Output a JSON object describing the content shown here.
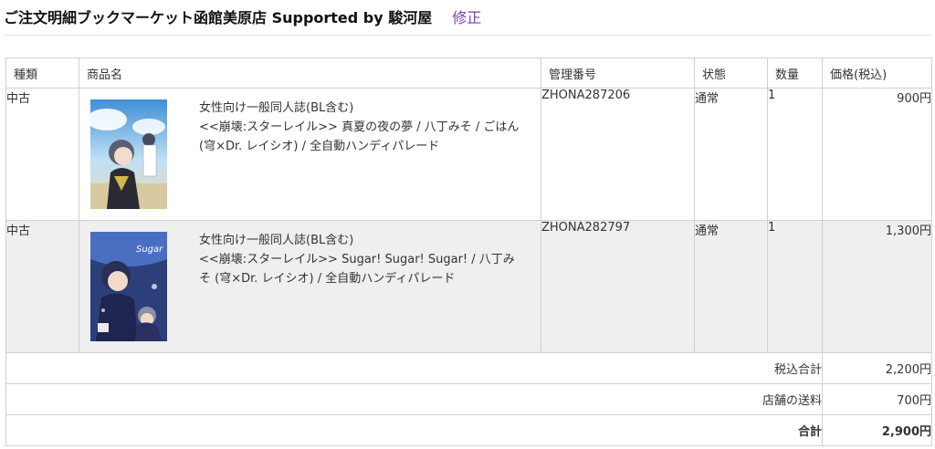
{
  "header": {
    "title": "ご注文明細ブックマーケット函館美原店 Supported by 駿河屋",
    "edit_label": "修正"
  },
  "table": {
    "columns": {
      "type": "種類",
      "product": "商品名",
      "code": "管理番号",
      "status": "状態",
      "qty": "数量",
      "price": "価格(税込)"
    },
    "items": [
      {
        "condition": "中古",
        "category": "女性向け一般同人誌(BL含む)",
        "title_line1": "<<崩壊:スターレイル>> 真夏の夜の夢 / 八丁みそ / ごはん",
        "title_line2": "(穹×Dr. レイシオ) / 全自動ハンディパレード",
        "code": "ZHONA287206",
        "status": "通常",
        "qty": "1",
        "price": "900円",
        "thumb_icon": "book-cover-image"
      },
      {
        "condition": "中古",
        "category": "女性向け一般同人誌(BL含む)",
        "title_line1": "<<崩壊:スターレイル>> Sugar! Sugar! Sugar! / 八丁み",
        "title_line2": "そ (穹×Dr. レイシオ) / 全自動ハンディパレード",
        "code": "ZHONA282797",
        "status": "通常",
        "qty": "1",
        "price": "1,300円",
        "thumb_icon": "book-cover-image"
      }
    ],
    "totals": [
      {
        "label": "税込合計",
        "value": "2,200円"
      },
      {
        "label": "店舗の送料",
        "value": "700円"
      },
      {
        "label": "合計",
        "value": "2,900円"
      }
    ]
  },
  "colors": {
    "accent_link": "#7a3fa8",
    "row_alt_bg": "#efefef",
    "border": "#d0d0d0"
  }
}
